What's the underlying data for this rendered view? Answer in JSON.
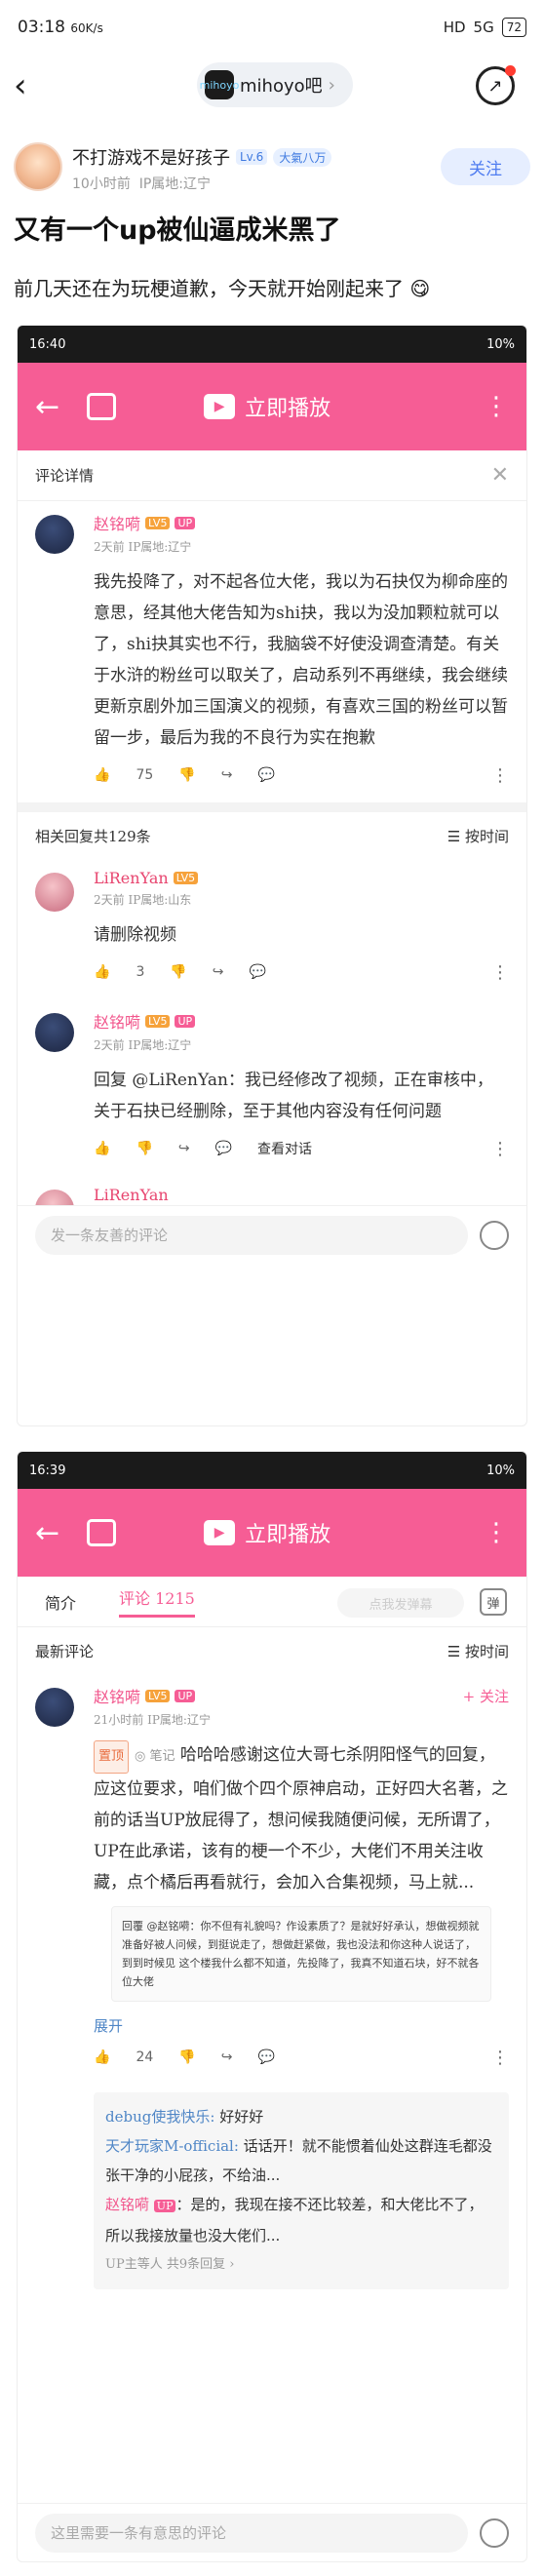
{
  "status": {
    "time": "03:18",
    "data_rate": "60K/s",
    "carrier": "HD",
    "network": "5G",
    "battery": "72"
  },
  "header": {
    "forum": "mihoyo吧",
    "forum_logo": "mihoyo"
  },
  "author": {
    "name": "不打游戏不是好孩子",
    "level": "Lv.6",
    "rank": "大氣八万",
    "time": "10小时前",
    "ip": "IP属地:辽宁",
    "follow": "关注"
  },
  "post": {
    "title": "又有一个up被仙逼成米黑了",
    "content": "前几天还在为玩梗道歉，今天就开始刚起来了"
  },
  "shot1": {
    "time": "16:40",
    "battery": "10%",
    "play_label": "立即播放",
    "panel_title": "评论详情",
    "comment": {
      "name": "赵铭嗬",
      "level": "LV5",
      "up": "UP",
      "time": "2天前 IP属地:辽宁",
      "text": "我先投降了，对不起各位大佬，我以为石抉仅为柳命座的意思，经其他大佬告知为shi抉，我以为没加颗粒就可以了，shi抉其实也不行，我脑袋不好使没调查清楚。有关于水浒的粉丝可以取关了，启动系列不再继续，我会继续更新京剧外加三国演义的视频，有喜欢三国的粉丝可以暂留一步，最后为我的不良行为实在抱歉",
      "likes": "75"
    },
    "related": "相关回复共129条",
    "sort": "按时间",
    "r1": {
      "name": "LiRenYan",
      "level": "LV5",
      "time": "2天前 IP属地:山东",
      "text": "请删除视频",
      "likes": "3"
    },
    "r2": {
      "name": "赵铭嗬",
      "level": "LV5",
      "up": "UP",
      "time": "2天前 IP属地:辽宁",
      "text": "回复 @LiRenYan：我已经修改了视频，正在审核中，关于石抉已经删除，至于其他内容没有任何问题",
      "view": "查看对话"
    },
    "r3": {
      "name": "LiRenYan"
    },
    "input": "发一条友善的评论"
  },
  "shot2": {
    "time": "16:39",
    "battery": "10%",
    "play_label": "立即播放",
    "tab_intro": "简介",
    "tab_comments": "评论 1215",
    "danmaku": "点我发弹幕",
    "danmaku_btn": "弹",
    "newest": "最新评论",
    "sort": "按时间",
    "comment": {
      "name": "赵铭嗬",
      "level": "LV5",
      "up": "UP",
      "time": "21小时前 IP属地:辽宁",
      "follow": "+ 关注",
      "pin": "置顶",
      "note": "笔记",
      "text": "哈哈哈感谢这位大哥七杀阴阳怪气的回复，应这位要求，咱们做个四个原神启动，正好四大名著，之前的话当UP放屁得了，想问候我随便问候，无所谓了，UP在此承诺，该有的梗一个不少，大佬们不用关注收藏，点个橘后再看就行，会加入合集视频，马上就...",
      "shot_text": "回覆 @赵铭嗬：你不但有礼貌吗？作设素质了？是就好好承认，想做视频就准备好被人问候，到挺说走了，想做赶紧做，我也没法和你这种人说话了，到到时候见 这个楼我什么都不知道，先投降了，我真不知道石块，好不就各位大佬",
      "expand": "展开",
      "likes": "24"
    },
    "replies": [
      {
        "who": "debug使我快乐:",
        "text": "好好好"
      },
      {
        "who": "天才玩家M-official:",
        "text": "话话开！就不能惯着仙处这群连毛都没张干净的小屁孩，不给油..."
      },
      {
        "who": "赵铭嗬",
        "text": "是的，我现在接不还比较差，和大佬比不了，所以我接放量也没大佬们..."
      }
    ],
    "replies_more": "UP主等人 共9条回复",
    "input": "这里需要一条有意思的评论"
  },
  "colors": {
    "pink": "#f65d95",
    "blue": "#4f7cf0"
  }
}
